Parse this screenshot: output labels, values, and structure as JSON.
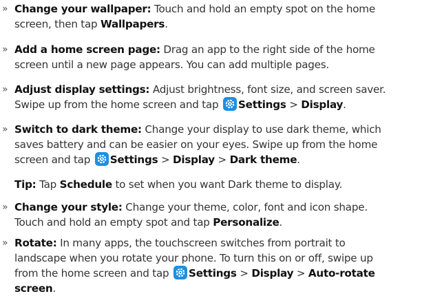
{
  "colors": {
    "text": "#333333",
    "bold": "#111111",
    "settings_icon_bg": "#1f8fe0"
  },
  "bullet_glyph": "»",
  "items": {
    "wallpaper": {
      "head": "Change your wallpaper:",
      "l1": "Touch and hold an empty spot on the home",
      "l2a": "screen, then tap",
      "l2b": "Wallpapers",
      "l2c": "."
    },
    "homepage": {
      "head": "Add a home screen page:",
      "l1": "Drag an app to the right side of the home",
      "l2": "screen until a new page appears. You can add multiple pages."
    },
    "display": {
      "head": "Adjust display settings:",
      "l1": "Adjust brightness, font size, and screen saver.",
      "l2a": "Swipe up from the home screen and tap",
      "s1": "Settings",
      "sep1": ">",
      "s2": "Display",
      "end": "."
    },
    "dark": {
      "head": "Switch to dark theme:",
      "l1": "Change your display to use dark theme, which",
      "l2": "saves battery and can be easier on your eyes. Swipe up from the home",
      "l3a": "screen and tap",
      "s1": "Settings",
      "sep1": ">",
      "s2": "Display",
      "sep2": ">",
      "s3": "Dark theme",
      "end": "."
    },
    "tip": {
      "head": "Tip:",
      "a": "Tap",
      "b": "Schedule",
      "c": "to set when you want Dark theme to display."
    },
    "style": {
      "head": "Change your style:",
      "l1": "Change your theme, color, font and icon shape.",
      "l2a": "Touch and hold an empty spot and tap",
      "l2b": "Personalize",
      "l2c": "."
    },
    "rotate": {
      "head": "Rotate:",
      "l1": "In many apps, the touchscreen switches from portrait to",
      "l2": "landscape when you rotate your phone. To turn this on or off, swipe up",
      "l3a": "from the home screen and tap",
      "s1": "Settings",
      "sep1": ">",
      "s2": "Display",
      "sep2": ">",
      "s3": "Auto-rotate",
      "l4": "screen",
      "end": "."
    }
  }
}
